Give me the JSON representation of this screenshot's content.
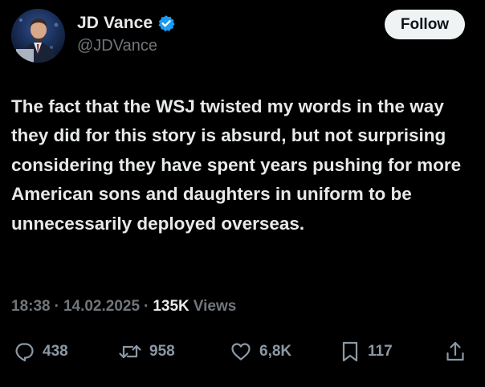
{
  "author": {
    "display_name": "JD Vance",
    "handle": "@JDVance",
    "verified": true
  },
  "follow_button": {
    "label": "Follow"
  },
  "tweet": {
    "text": "The fact that the WSJ twisted my words in the way they did for this story is absurd, but not surprising considering they have spent years pushing for more American sons and daughters in uniform to be unnecessarily deployed overseas.",
    "time": "18:38",
    "date": "14.02.2025",
    "separator": "·",
    "views_count": "135K",
    "views_label": "Views"
  },
  "actions": {
    "reply": {
      "icon": "reply-icon",
      "count": "438"
    },
    "retweet": {
      "icon": "retweet-icon",
      "count": "958"
    },
    "like": {
      "icon": "heart-icon",
      "count": "6,8K"
    },
    "bookmark": {
      "icon": "bookmark-icon",
      "count": "117"
    },
    "share": {
      "icon": "share-icon"
    }
  },
  "colors": {
    "background": "#000000",
    "primary_text": "#e7e9ea",
    "secondary_text": "#71767b",
    "verified_badge": "#1d9bf0",
    "follow_bg": "#eff3f4",
    "follow_text": "#0f1419"
  }
}
